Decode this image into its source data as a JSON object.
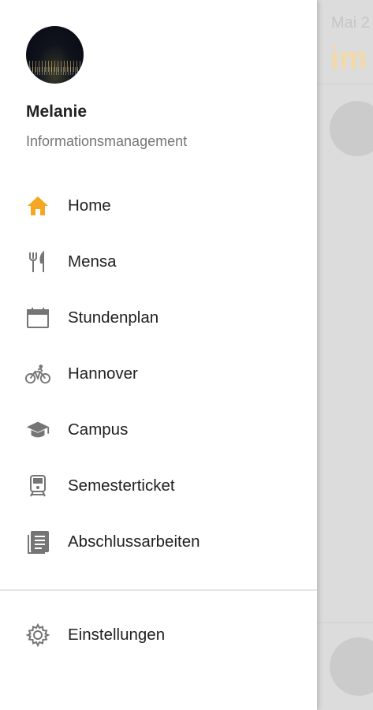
{
  "background": {
    "date_fragment": "Mai 2",
    "headline_fragment": "im",
    "accent": "#f3d9a8"
  },
  "drawer": {
    "user": {
      "name": "Melanie",
      "department": "Informationsmanagement"
    },
    "menu_items": [
      {
        "label": "Home",
        "icon": "home-icon",
        "active": true,
        "color": "#f5a623"
      },
      {
        "label": "Mensa",
        "icon": "fork-knife-icon",
        "color": "#757575"
      },
      {
        "label": "Stundenplan",
        "icon": "calendar-icon",
        "color": "#757575"
      },
      {
        "label": "Hannover",
        "icon": "bicycle-icon",
        "color": "#757575"
      },
      {
        "label": "Campus",
        "icon": "graduation-cap-icon",
        "color": "#757575"
      },
      {
        "label": "Semesterticket",
        "icon": "train-icon",
        "color": "#757575"
      },
      {
        "label": "Abschlussarbeiten",
        "icon": "document-list-icon",
        "color": "#757575"
      }
    ],
    "settings": {
      "label": "Einstellungen",
      "icon": "gear-icon"
    }
  }
}
